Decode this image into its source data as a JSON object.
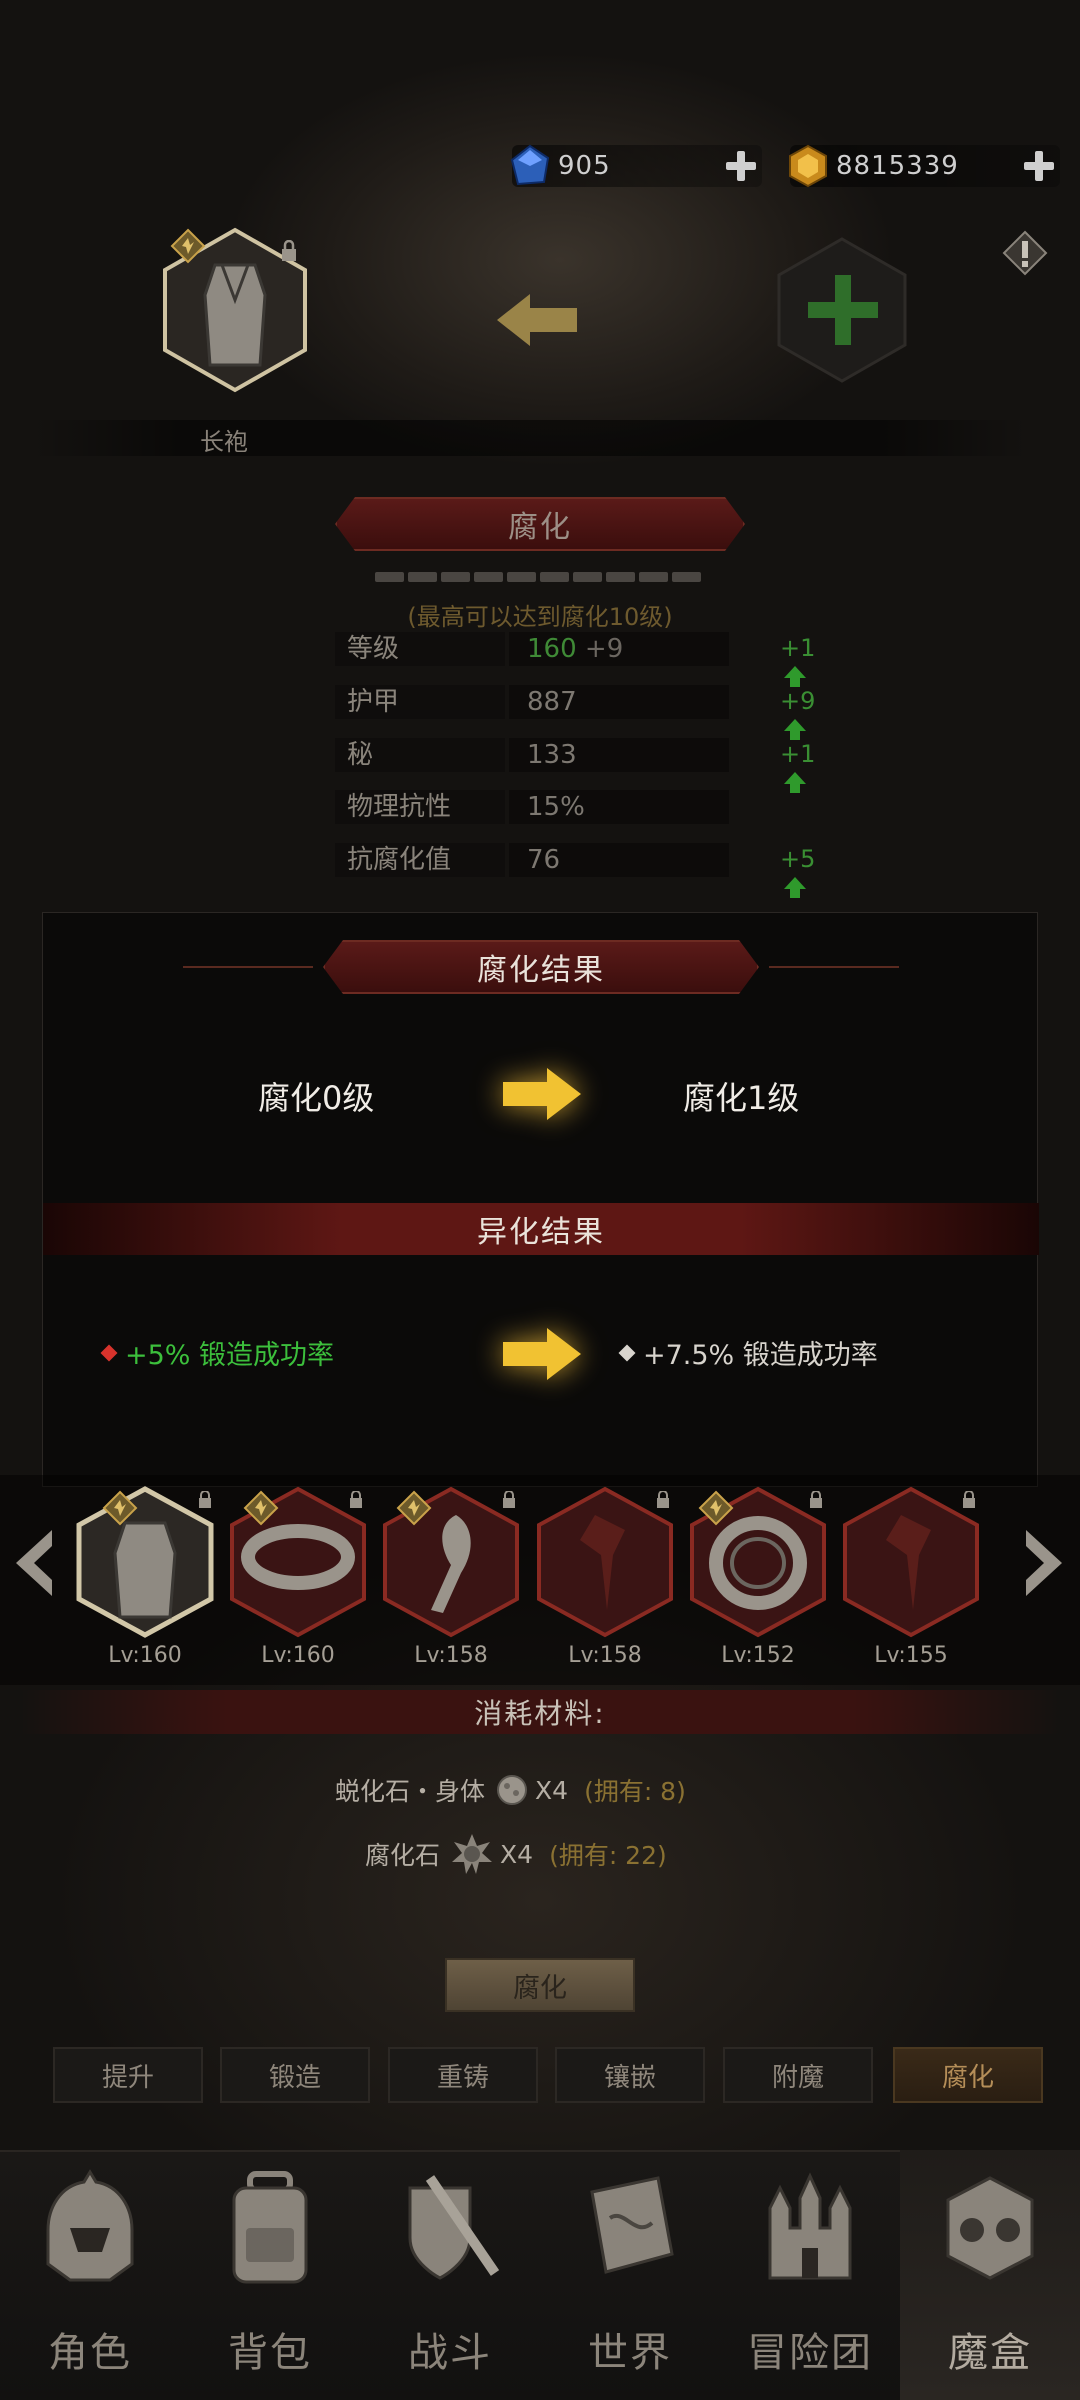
{
  "resources": {
    "gems": "905",
    "gold": "8815339"
  },
  "slot_label": "长袍",
  "panel": {
    "title": "腐化",
    "hint": "(最高可以达到腐化10级)",
    "stats": [
      {
        "name": "等级",
        "value": "160",
        "extra": "+9",
        "increase": "+1"
      },
      {
        "name": "护甲",
        "value": "887",
        "extra": "",
        "increase": "+9"
      },
      {
        "name": "秘",
        "value": "133",
        "extra": "",
        "increase": "+1"
      },
      {
        "name": "物理抗性",
        "value": "15%",
        "extra": "",
        "increase": ""
      },
      {
        "name": "抗腐化值",
        "value": "76",
        "extra": "",
        "increase": "+5"
      }
    ]
  },
  "dialog": {
    "title": "腐化结果",
    "from_level": "腐化0级",
    "to_level": "腐化1级",
    "alien_title": "异化结果",
    "alien_from": "+5%  锻造成功率",
    "alien_to": "+7.5%  锻造成功率",
    "colors": {
      "from": "#3cbf3c",
      "to": "#d8d4cd",
      "arrow": "#f1c232"
    }
  },
  "items": [
    {
      "lv": "Lv:160"
    },
    {
      "lv": "Lv:160"
    },
    {
      "lv": "Lv:158"
    },
    {
      "lv": "Lv:158"
    },
    {
      "lv": "Lv:152"
    },
    {
      "lv": "Lv:155"
    }
  ],
  "consume": {
    "title": "消耗材料:",
    "materials": [
      {
        "name": "蜕化石・身体",
        "qty": "X4",
        "own": "(拥有: 8)"
      },
      {
        "name": "腐化石",
        "qty": "X4",
        "own": "(拥有: 22)"
      }
    ]
  },
  "action_button": "腐化",
  "tabs": [
    "提升",
    "锻造",
    "重铸",
    "镶嵌",
    "附魔",
    "腐化"
  ],
  "bottom_nav": [
    "角色",
    "背包",
    "战斗",
    "世界",
    "冒险团",
    "魔盒"
  ]
}
